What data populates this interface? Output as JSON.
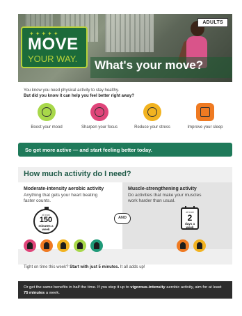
{
  "hero": {
    "badge": "ADULTS",
    "logo_line1": "MOVE",
    "logo_line2": "YOUR WAY.",
    "title": "What's your move?"
  },
  "intro": {
    "line1": "You know you need physical activity to stay healthy.",
    "line2": "But did you know it can help you feel better right away?"
  },
  "benefits": [
    {
      "label": "Boost your mood",
      "color": "#a8d84a",
      "icon": "smiley-icon"
    },
    {
      "label": "Sharpen your focus",
      "color": "#e0457a",
      "icon": "brain-icon"
    },
    {
      "label": "Reduce your stress",
      "color": "#f2b320",
      "icon": "meditation-icon"
    },
    {
      "label": "Improve your sleep",
      "color": "#ef7a22",
      "icon": "sleep-icon"
    }
  ],
  "cta": "So get more active — and start feeling better today.",
  "activity": {
    "title": "How much activity do I need?",
    "aerobic": {
      "title": "Moderate-intensity aerobic activity",
      "desc": "Anything that gets your heart beating faster counts.",
      "at_least": "at least",
      "amount": "150",
      "unit": "minutes a week"
    },
    "and_label": "AND",
    "muscle": {
      "title": "Muscle-strengthening activity",
      "desc": "Do activities that make your muscles work harder than usual.",
      "at_least": "at least",
      "amount": "2",
      "unit": "days a week"
    },
    "aerobic_icons": [
      {
        "name": "cycling-icon",
        "color": "#e0457a"
      },
      {
        "name": "swimming-icon",
        "color": "#ef7a22"
      },
      {
        "name": "dog-walking-icon",
        "color": "#f2b320"
      },
      {
        "name": "wheelchair-icon",
        "color": "#a8d84a"
      },
      {
        "name": "dancing-icon",
        "color": "#1f9a78"
      }
    ],
    "muscle_icons": [
      {
        "name": "weightlifting-icon",
        "color": "#ef7a22"
      },
      {
        "name": "pushup-icon",
        "color": "#f2b320"
      }
    ]
  },
  "tight": {
    "pre": "Tight on time this week?",
    "bold": "Start with just 5 minutes.",
    "post": "It all adds up!"
  },
  "vigorous": {
    "a": "Or get the same benefits in half the time. If you step it up to",
    "b": "vigorous-intensity",
    "c": "aerobic activity, aim for at least",
    "d": "75 minutes",
    "e": "a week."
  },
  "colors": {
    "brand_green": "#1f7a5a",
    "title_green": "#1f5a48",
    "logo_lime": "#b8d33a"
  }
}
